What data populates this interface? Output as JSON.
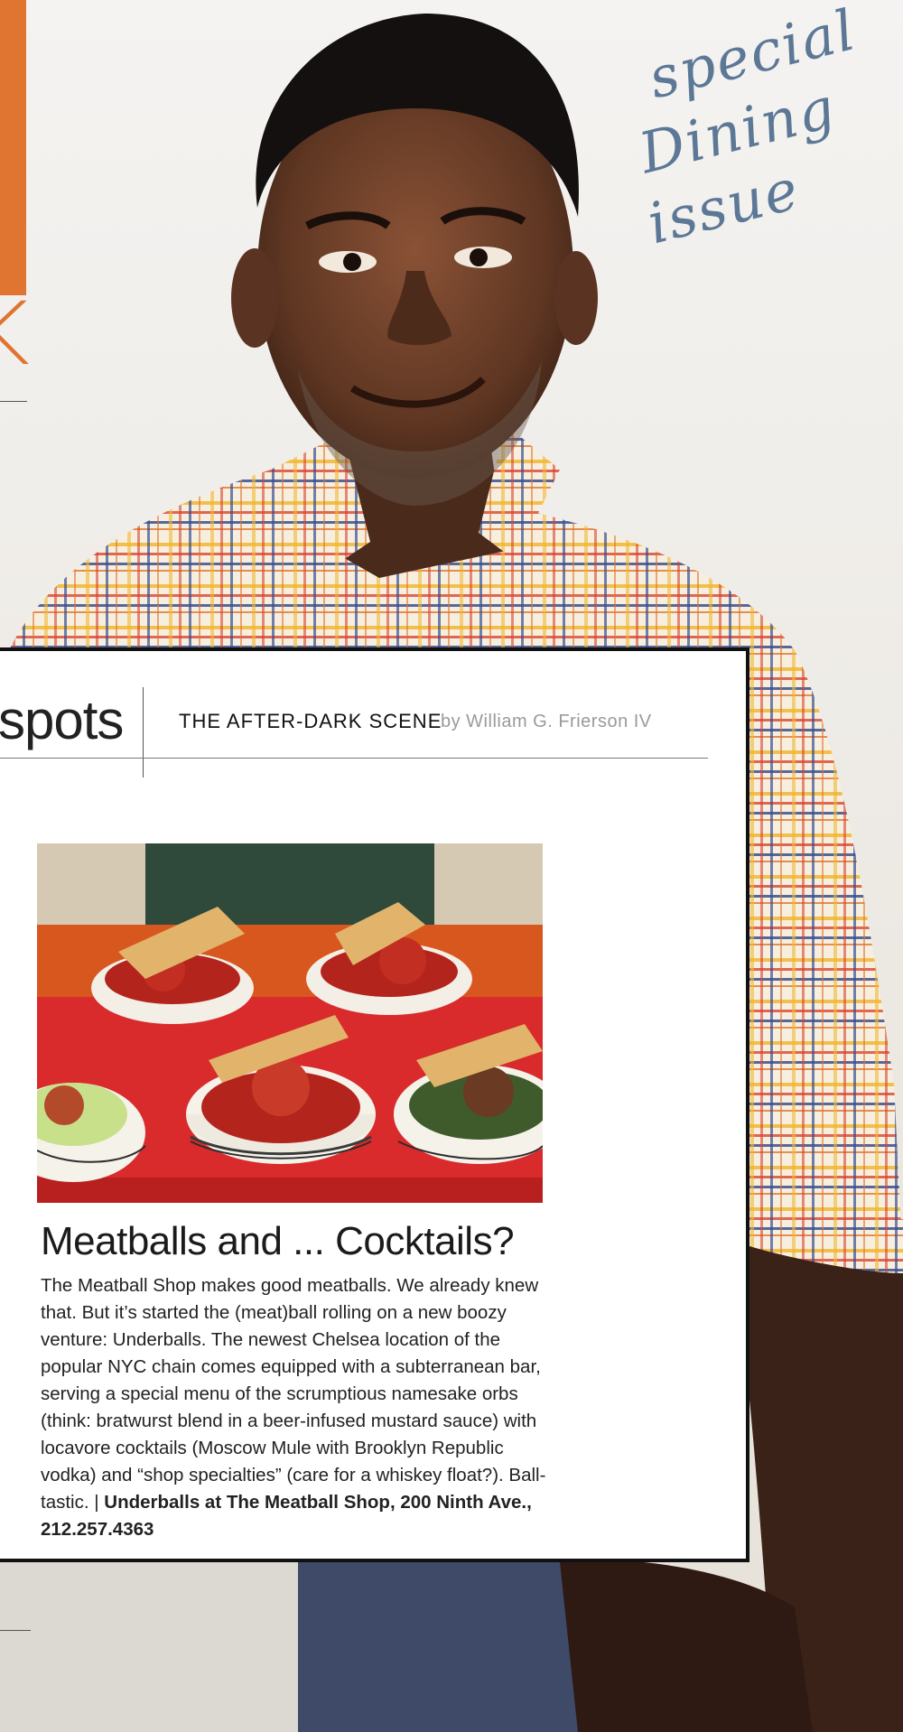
{
  "cover": {
    "handwritten_lines": [
      "special",
      "Dining",
      "issue"
    ],
    "edge_letter": "K"
  },
  "article": {
    "section": "spots",
    "kicker": "THE AFTER-DARK SCENE",
    "byline": "by William G. Frierson IV",
    "headline": "Meatballs and ... Cocktails?",
    "body": "The Meatball Shop makes good meatballs. We already knew that. But it’s started the (meat)ball rolling on a new boozy venture: Underballs. The newest Chelsea location of the popular NYC chain comes equipped with a subterranean bar, serving a special menu of the scrumptious namesake orbs (think: bratwurst blend in a beer-infused mustard sauce) with locavore cocktails (Moscow Mule with Brooklyn Republic vodka) and “shop specialties” (care for a whiskey float?). Ball-tastic. |",
    "info": "Underballs at The Meatball Shop, 200 Ninth Ave., 212.257.4363"
  },
  "colors": {
    "accent_orange": "#e07431",
    "script_blue": "#5c7896",
    "tray_red": "#d92b2b"
  }
}
